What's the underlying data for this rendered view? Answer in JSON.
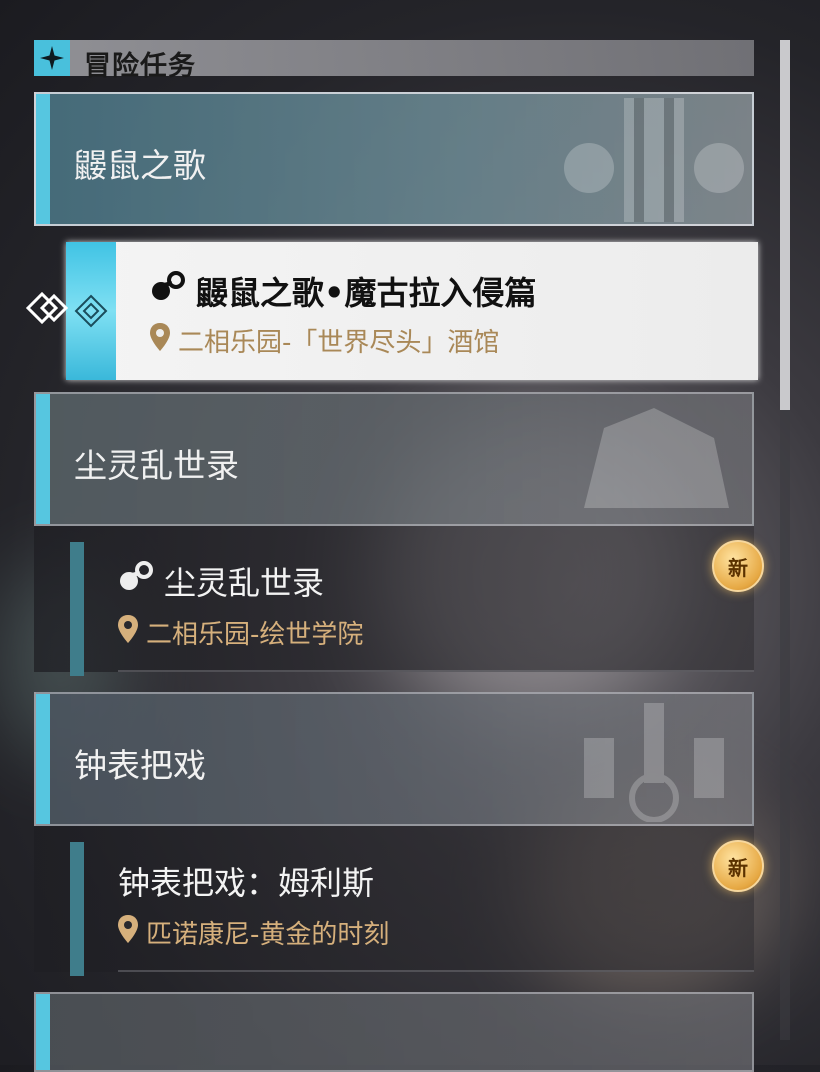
{
  "header": {
    "title": "冒险任务",
    "icon": "sparkle-icon",
    "accent_color": "#49c0dc"
  },
  "categories": [
    {
      "title": "鼹鼠之歌"
    },
    {
      "title": "尘灵乱世录"
    },
    {
      "title": "钟表把戏"
    },
    {
      "title": ""
    }
  ],
  "selected_quest": {
    "name": "鼹鼠之歌•魔古拉入侵篇",
    "location": "二相乐园-「世界尽头」酒馆",
    "icon": "quest-type-icon"
  },
  "quests": [
    {
      "name": "尘灵乱世录",
      "location": "二相乐园-绘世学院",
      "badge": "新",
      "icon": "quest-type-icon"
    },
    {
      "name": "钟表把戏：姆利斯",
      "location": "匹诺康尼-黄金的时刻",
      "badge": "新"
    }
  ],
  "colors": {
    "accent": "#56c6e0",
    "location_text": "#d6b07c",
    "badge": "#e6a843"
  }
}
